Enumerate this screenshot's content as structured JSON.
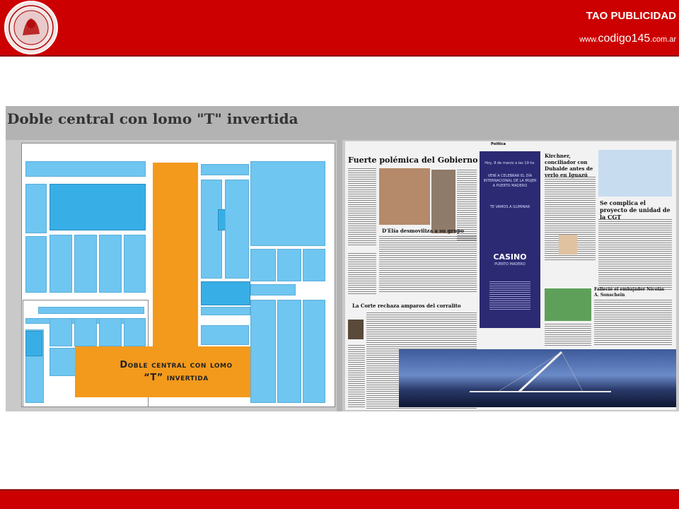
{
  "header": {
    "brand": "TAO PUBLICIDAD",
    "url_prefix": "www.",
    "url_main": "codigo145",
    "url_suffix": ".com.ar",
    "seal_icon": "university-seal-icon",
    "colors": {
      "bar": "#cc0000",
      "text": "#ffffff"
    }
  },
  "slide": {
    "title": "Doble central con lomo \"T\" invertida",
    "diagram_label_line1": "Doble central con lomo",
    "diagram_label_line2": "“T” invertida",
    "colors": {
      "block": "#6fc6f0",
      "spine": "#f39a1c",
      "background": "#b3b3b3"
    }
  },
  "newspaper": {
    "section": "Política",
    "headline_main": "Fuerte polémica del Gobierno",
    "headline_sub": "D'Elía desmoviliza a su grupo",
    "headline_corte": "La Corte rechaza amparos del corralito",
    "headline_kirchner": "Kirchner, conciliador con Duhalde antes de verlo en Iguazú",
    "headline_cgt": "Se complica el proyecto de unidad de la CGT",
    "headline_falleció": "Falleció el embajador Nicolás A. Sonschein",
    "ad_line1": "Hoy, 8 de marzo a las 19 hs.",
    "ad_line2": "VENÍ A CELEBRAR EL DÍA INTERNACIONAL DE LA MUJER A PUERTO MADERO",
    "ad_line3": "TE VAMOS A ILUMINAR",
    "ad_brand": "CASINO",
    "ad_brand_sub": "PUERTO MADERO"
  }
}
